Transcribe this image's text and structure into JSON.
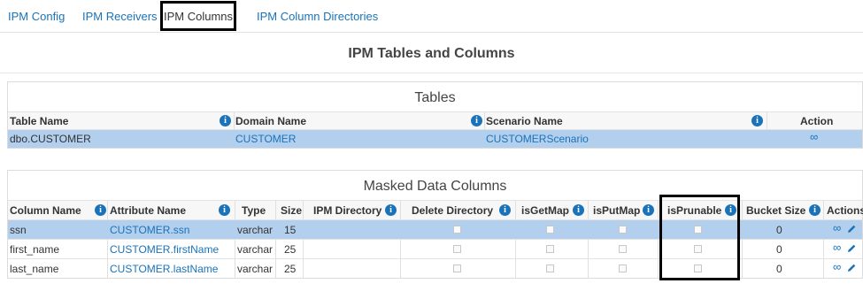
{
  "tabs": [
    {
      "label": "IPM Config"
    },
    {
      "label": "IPM Receivers"
    },
    {
      "label": "IPM Columns",
      "active": true
    },
    {
      "label": "IPM Column Directories"
    }
  ],
  "page_title": "IPM Tables and Columns",
  "tables_panel": {
    "title": "Tables",
    "headers": {
      "table_name": "Table Name",
      "domain_name": "Domain Name",
      "scenario_name": "Scenario Name",
      "action": "Action"
    },
    "rows": [
      {
        "table_name": "dbo.CUSTOMER",
        "domain_name": "CUSTOMER",
        "scenario_name": "CUSTOMERScenario",
        "action_icon": "link-icon",
        "selected": true
      }
    ]
  },
  "masked_panel": {
    "title": "Masked Data Columns",
    "headers": {
      "column_name": "Column Name",
      "attribute_name": "Attribute Name",
      "type": "Type",
      "size": "Size",
      "ipm_directory": "IPM Directory",
      "delete_directory": "Delete Directory",
      "is_get_map": "isGetMap",
      "is_put_map": "isPutMap",
      "is_prunable": "isPrunable",
      "bucket_size": "Bucket Size",
      "actions": "Actions"
    },
    "rows": [
      {
        "column_name": "ssn",
        "attribute_name": "CUSTOMER.ssn",
        "type": "varchar",
        "size": "15",
        "ipm_directory": "",
        "bucket_size": "0",
        "selected": true
      },
      {
        "column_name": "first_name",
        "attribute_name": "CUSTOMER.firstName",
        "type": "varchar",
        "size": "25",
        "ipm_directory": "",
        "bucket_size": "0",
        "selected": false
      },
      {
        "column_name": "last_name",
        "attribute_name": "CUSTOMER.lastName",
        "type": "varchar",
        "size": "25",
        "ipm_directory": "",
        "bucket_size": "0",
        "selected": false
      }
    ]
  },
  "info_glyph": "i",
  "icons": {
    "link": "link-icon",
    "edit": "pencil-icon",
    "info": "info-icon"
  },
  "colors": {
    "link": "#1a73b8",
    "selected_row": "#b3cfee",
    "highlight": "#000000"
  }
}
